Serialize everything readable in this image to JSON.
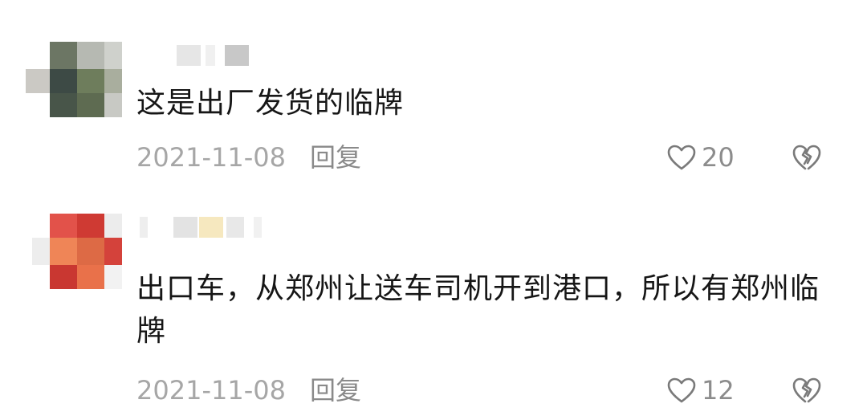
{
  "comments": [
    {
      "text": "这是出厂发货的临牌",
      "date": "2021-11-08",
      "reply_label": "回复",
      "like_count": "20",
      "avatar_colors": [
        "#5b6651",
        "#8a9179",
        "#c9cbc6",
        "#47514a",
        "#6b7b5c",
        "#9aa38e",
        "#3a473f",
        "#626f55"
      ]
    },
    {
      "text": "出口车，从郑州让送车司机开到港口，所以有郑州临牌",
      "date": "2021-11-08",
      "reply_label": "回复",
      "like_count": "12",
      "avatar_colors": [
        "#d9423a",
        "#e8703f",
        "#c63a34",
        "#ef8a56",
        "#d65a44",
        "#b9322f"
      ]
    }
  ],
  "colors": {
    "text": "#161616",
    "meta": "#a6a6a6",
    "icon_stroke": "#7a7a7a"
  },
  "icons": {
    "like": "heart-outline",
    "dislike": "broken-heart-outline"
  }
}
